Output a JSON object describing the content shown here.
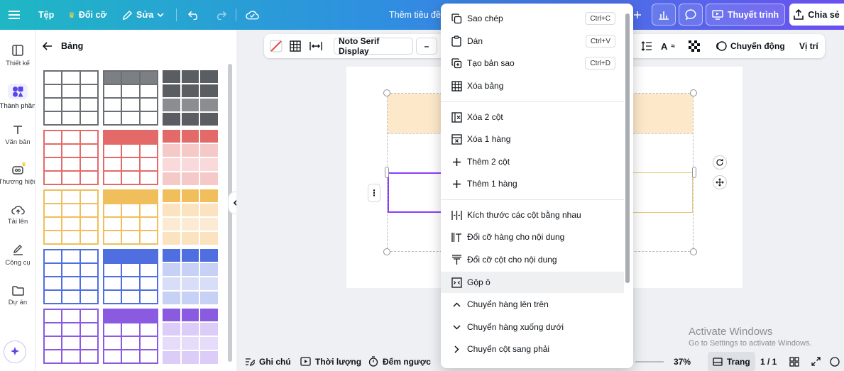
{
  "topbar": {
    "file_label": "Tệp",
    "resize_label": "Đổi cỡ",
    "edit_label": "Sửa",
    "doc_title": "Thêm tiêu đề",
    "present_label": "Thuyết trình",
    "share_label": "Chia sẻ"
  },
  "rail": {
    "items": [
      {
        "label": "Thiết kế"
      },
      {
        "label": "Thành phần"
      },
      {
        "label": "Văn bản"
      },
      {
        "label": "Thương hiệu"
      },
      {
        "label": "Tải lên"
      },
      {
        "label": "Công cụ"
      },
      {
        "label": "Dự án"
      }
    ]
  },
  "panel": {
    "title": "Bảng",
    "tables": [
      {
        "style": "header-dark",
        "border": "#6b6e73",
        "header": "#7c7f84",
        "fill": "#ffffff"
      },
      {
        "style": "header-gray",
        "border": "#6b6e73",
        "header": "#7c7f84",
        "fill": "#ffffff"
      },
      {
        "style": "solid-dark",
        "border": "#ffffff",
        "header": "#5a5d62",
        "fill": "#5a5d62"
      },
      {
        "style": "outline-red",
        "border": "#e46a6a",
        "header": "#ffffff",
        "fill": "#ffffff"
      },
      {
        "style": "header-red",
        "border": "#e46a6a",
        "header": "#e46a6a",
        "fill": "#ffffff"
      },
      {
        "style": "solid-red",
        "border": "#ffffff",
        "header": "#e46a6a",
        "fill": "#f6c9c9"
      },
      {
        "style": "outline-yellow",
        "border": "#f0bf5c",
        "header": "#ffffff",
        "fill": "#ffffff"
      },
      {
        "style": "header-yellow",
        "border": "#f0bf5c",
        "header": "#f0bf5c",
        "fill": "#ffffff"
      },
      {
        "style": "solid-yellow",
        "border": "#ffffff",
        "header": "#f0bf5c",
        "fill": "#fbe3bf"
      },
      {
        "style": "outline-blue",
        "border": "#4f6fe0",
        "header": "#ffffff",
        "fill": "#ffffff"
      },
      {
        "style": "header-blue",
        "border": "#4f6fe0",
        "header": "#4f6fe0",
        "fill": "#ffffff"
      },
      {
        "style": "solid-blue",
        "border": "#ffffff",
        "header": "#4f6fe0",
        "fill": "#c7d0f5"
      },
      {
        "style": "outline-purple",
        "border": "#8a5ae0",
        "header": "#ffffff",
        "fill": "#ffffff"
      },
      {
        "style": "header-purple",
        "border": "#8a5ae0",
        "header": "#8a5ae0",
        "fill": "#ffffff"
      },
      {
        "style": "solid-purple",
        "border": "#ffffff",
        "header": "#8a5ae0",
        "fill": "#dbcdf7"
      }
    ]
  },
  "toolbar": {
    "font_name": "Noto Serif Display",
    "font_size_minus": "–",
    "animate_label": "Chuyển động",
    "position_label": "Vị trí"
  },
  "menu": {
    "items": [
      {
        "label": "Sao chép",
        "shortcut": "Ctrl+C",
        "icon": "copy-icon"
      },
      {
        "label": "Dán",
        "shortcut": "Ctrl+V",
        "icon": "paste-icon"
      },
      {
        "label": "Tạo bản sao",
        "shortcut": "Ctrl+D",
        "icon": "duplicate-icon"
      },
      {
        "label": "Xóa bảng",
        "shortcut": "",
        "icon": "table-icon"
      },
      {
        "label": "Xóa 2 cột",
        "shortcut": "",
        "icon": "delete-column-icon"
      },
      {
        "label": "Xóa 1 hàng",
        "shortcut": "",
        "icon": "delete-row-icon"
      },
      {
        "label": "Thêm 2 cột",
        "shortcut": "",
        "icon": "plus-icon"
      },
      {
        "label": "Thêm 1 hàng",
        "shortcut": "",
        "icon": "plus-icon"
      },
      {
        "label": "Kích thước các cột bằng nhau",
        "shortcut": "",
        "icon": "equal-columns-icon"
      },
      {
        "label": "Đổi cỡ hàng cho nội dung",
        "shortcut": "",
        "icon": "fit-row-icon"
      },
      {
        "label": "Đổi cỡ cột cho nội dung",
        "shortcut": "",
        "icon": "fit-column-icon"
      },
      {
        "label": "Gộp ô",
        "shortcut": "",
        "icon": "merge-cells-icon"
      },
      {
        "label": "Chuyển hàng lên trên",
        "shortcut": "",
        "icon": "chevron-up-icon"
      },
      {
        "label": "Chuyển hàng xuống dưới",
        "shortcut": "",
        "icon": "chevron-down-icon"
      },
      {
        "label": "Chuyển cột sang phải",
        "shortcut": "",
        "icon": "chevron-right-icon"
      }
    ]
  },
  "bottombar": {
    "notes_label": "Ghi chú",
    "duration_label": "Thời lượng",
    "timer_label": "Đếm ngược",
    "zoom": "37%",
    "pages_label": "Trang",
    "page_count": "1 / 1"
  },
  "watermark": {
    "line1": "Activate Windows",
    "line2": "Go to Settings to activate Windows."
  },
  "colors": {
    "accent": "#8b3dff",
    "table_header": "#fde9c9"
  }
}
